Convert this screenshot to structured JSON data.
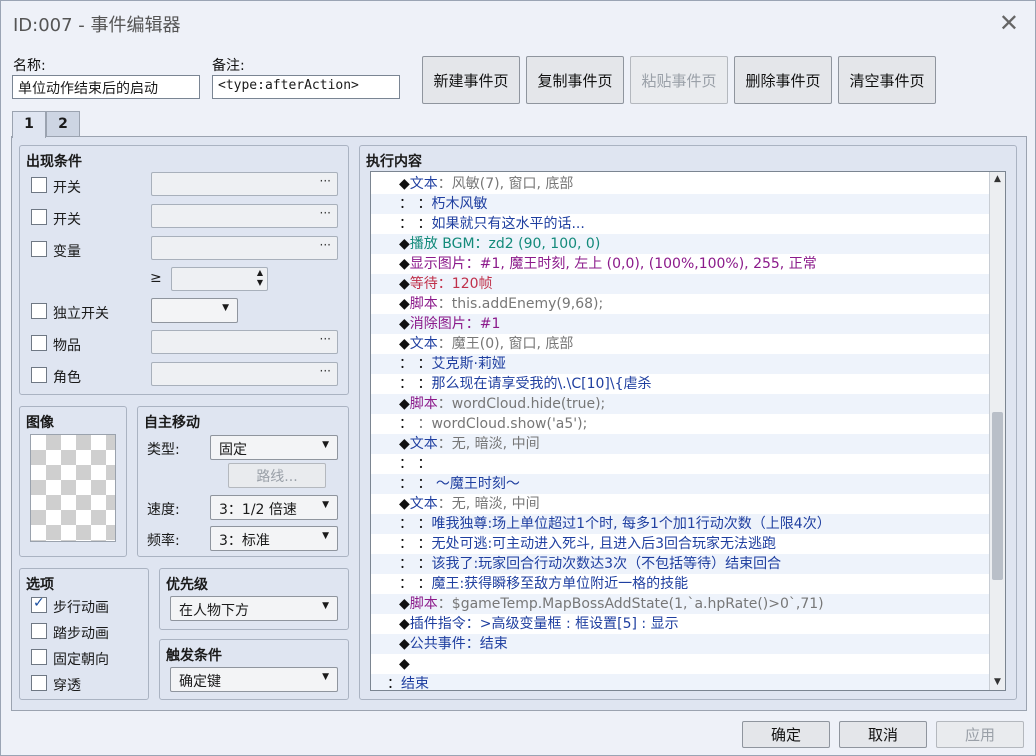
{
  "window": {
    "title": "ID:007 - 事件编辑器",
    "close_glyph": "✕"
  },
  "name_field": {
    "label": "名称:",
    "value": "单位动作结束后的启动"
  },
  "note_field": {
    "label": "备注:",
    "value": "<type:afterAction>"
  },
  "page_buttons": {
    "new": "新建事件页",
    "copy": "复制事件页",
    "paste": "粘贴事件页",
    "delete": "删除事件页",
    "clear": "清空事件页"
  },
  "tabs": [
    "1",
    "2"
  ],
  "conditions": {
    "title": "出现条件",
    "switch1": "开关",
    "switch2": "开关",
    "variable": "变量",
    "ge_symbol": "≥",
    "self_switch": "独立开关",
    "item": "物品",
    "actor": "角色",
    "picker_dots": "···"
  },
  "image": {
    "title": "图像"
  },
  "autonomous": {
    "title": "自主移动",
    "type_label": "类型:",
    "type_value": "固定",
    "route_button": "路线...",
    "speed_label": "速度:",
    "speed_value": "3：1/2 倍速",
    "freq_label": "频率:",
    "freq_value": "3：标准"
  },
  "options": {
    "title": "选项",
    "walking": {
      "label": "步行动画",
      "checked": true
    },
    "stepping": {
      "label": "踏步动画",
      "checked": false
    },
    "direction_fix": {
      "label": "固定朝向",
      "checked": false
    },
    "through": {
      "label": "穿透",
      "checked": false
    }
  },
  "priority": {
    "title": "优先级",
    "value": "在人物下方"
  },
  "trigger": {
    "title": "触发条件",
    "value": "确定键"
  },
  "contents": {
    "title": "执行内容",
    "rows": [
      [
        {
          "t": "◆",
          "c": "#111"
        },
        {
          "t": "文本",
          "c": "#1f3fa0"
        },
        {
          "t": "：风敏(7), 窗口, 底部",
          "c": "#777"
        }
      ],
      [
        {
          "t": "：      ：",
          "c": "#111"
        },
        {
          "t": "朽木风敏",
          "c": "#1f3fa0"
        }
      ],
      [
        {
          "t": "：      ：",
          "c": "#111"
        },
        {
          "t": "如果就只有这水平的话...",
          "c": "#1f3fa0"
        }
      ],
      [
        {
          "t": "◆",
          "c": "#111"
        },
        {
          "t": "播放",
          "c": "#138a7a"
        },
        {
          "t": " BGM：zd2 (90, 100, 0)",
          "c": "#138a7a"
        }
      ],
      [
        {
          "t": "◆",
          "c": "#111"
        },
        {
          "t": "显示图片：#1, 魔王时刻, 左上 (0,0), (100%,100%), 255, 正常",
          "c": "#8b1a8b"
        }
      ],
      [
        {
          "t": "◆",
          "c": "#111"
        },
        {
          "t": "等待：120帧",
          "c": "#c0304a"
        }
      ],
      [
        {
          "t": "◆",
          "c": "#111"
        },
        {
          "t": "脚本",
          "c": "#8b1a8b"
        },
        {
          "t": "：this.addEnemy(9,68);",
          "c": "#777"
        }
      ],
      [
        {
          "t": "◆",
          "c": "#111"
        },
        {
          "t": "消除图片：#1",
          "c": "#8b1a8b"
        }
      ],
      [
        {
          "t": "◆",
          "c": "#111"
        },
        {
          "t": "文本",
          "c": "#1f3fa0"
        },
        {
          "t": "：魔王(0), 窗口, 底部",
          "c": "#777"
        }
      ],
      [
        {
          "t": "：      ：",
          "c": "#111"
        },
        {
          "t": "艾克斯·莉娅",
          "c": "#1f3fa0"
        }
      ],
      [
        {
          "t": "：      ：",
          "c": "#111"
        },
        {
          "t": "那么现在请享受我的\\.\\C[10]\\{虐杀",
          "c": "#1f3fa0"
        }
      ],
      [
        {
          "t": "◆",
          "c": "#111"
        },
        {
          "t": "脚本",
          "c": "#8b1a8b"
        },
        {
          "t": "：wordCloud.hide(true);",
          "c": "#777"
        }
      ],
      [
        {
          "t": "：      ",
          "c": "#111"
        },
        {
          "t": "：wordCloud.show('a5');",
          "c": "#777"
        }
      ],
      [
        {
          "t": "◆",
          "c": "#111"
        },
        {
          "t": "文本",
          "c": "#1f3fa0"
        },
        {
          "t": "：无, 暗淡, 中间",
          "c": "#777"
        }
      ],
      [
        {
          "t": "：      ：",
          "c": "#111"
        }
      ],
      [
        {
          "t": "：      ：",
          "c": "#111"
        },
        {
          "t": "                    ～魔王时刻～",
          "c": "#1f3fa0"
        }
      ],
      [
        {
          "t": "◆",
          "c": "#111"
        },
        {
          "t": "文本",
          "c": "#1f3fa0"
        },
        {
          "t": "：无, 暗淡, 中间",
          "c": "#777"
        }
      ],
      [
        {
          "t": "：      ：",
          "c": "#111"
        },
        {
          "t": "唯我独尊:场上单位超过1个时, 每多1个加1行动次数（上限4次）",
          "c": "#1f3fa0"
        }
      ],
      [
        {
          "t": "：      ：",
          "c": "#111"
        },
        {
          "t": "无处可逃:可主动进入死斗, 且进入后3回合玩家无法逃跑",
          "c": "#1f3fa0"
        }
      ],
      [
        {
          "t": "：      ：",
          "c": "#111"
        },
        {
          "t": "该我了:玩家回合行动次数达3次（不包括等待）结束回合",
          "c": "#1f3fa0"
        }
      ],
      [
        {
          "t": "：      ：",
          "c": "#111"
        },
        {
          "t": "魔王:获得瞬移至敌方单位附近一格的技能",
          "c": "#1f3fa0"
        }
      ],
      [
        {
          "t": "◆",
          "c": "#111"
        },
        {
          "t": "脚本",
          "c": "#8b1a8b"
        },
        {
          "t": "：$gameTemp.MapBossAddState(1,`a.hpRate()>0`,71)",
          "c": "#777"
        }
      ],
      [
        {
          "t": "◆",
          "c": "#111"
        },
        {
          "t": "插件指令：>高级变量框 : 框设置[5] : 显示",
          "c": "#1f3fa0"
        }
      ],
      [
        {
          "t": "◆",
          "c": "#111"
        },
        {
          "t": "公共事件：结束",
          "c": "#1f3fa0"
        }
      ],
      [
        {
          "t": "◆",
          "c": "#111"
        }
      ],
      [
        {
          "t": "：",
          "c": "#111"
        },
        {
          "t": "结束",
          "c": "#1f3fa0"
        }
      ]
    ]
  },
  "bottom": {
    "ok": "确定",
    "cancel": "取消",
    "apply": "应用"
  },
  "scroll": {
    "up": "▲",
    "down": "▼"
  }
}
